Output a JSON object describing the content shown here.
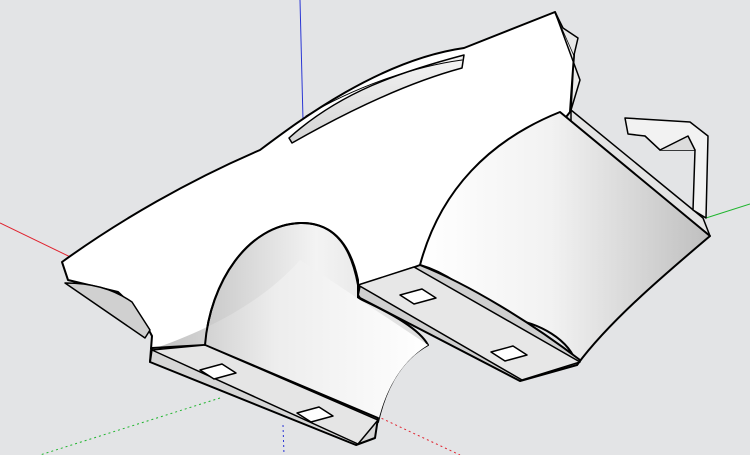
{
  "app": {
    "view": "perspective-3d-viewport",
    "background_color": "#e3e4e6"
  },
  "axes": {
    "red_axis_color": "#e0222e",
    "green_axis_color": "#1fb52e",
    "blue_axis_color": "#2a36d4"
  },
  "model": {
    "face_color": "#ffffff",
    "shade_light": "#e9e9e9",
    "shade_dark": "#b8b8b8",
    "edge_color": "#000000"
  }
}
